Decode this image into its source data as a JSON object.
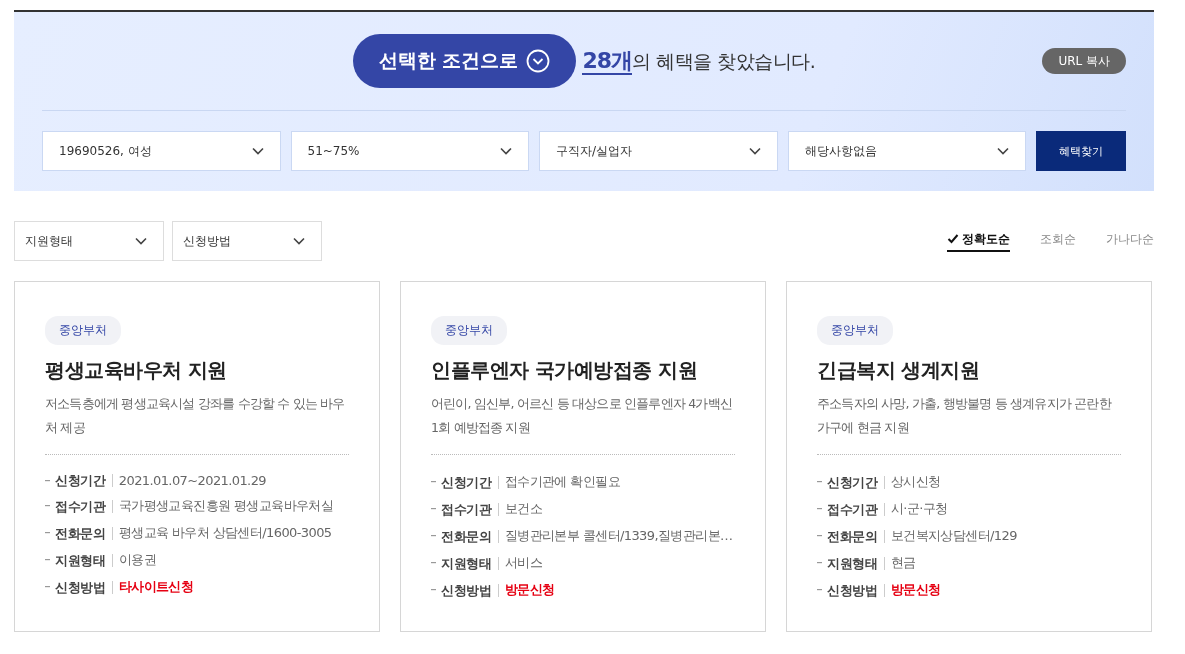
{
  "summary": {
    "toggle_label": "선택한 조건으로",
    "result_text": "**28개**의 혜택을 찾았습니다.",
    "copy_button": "URL 복사"
  },
  "conditions": [
    {
      "value": "19690526, 여성"
    },
    {
      "value": "51~75%"
    },
    {
      "value": "구직자/실업자"
    },
    {
      "value": "해당사항없음"
    }
  ],
  "search_button": "혜택찾기",
  "filters": [
    {
      "value": "지원형태"
    },
    {
      "value": "신청방법"
    }
  ],
  "sort_options": [
    {
      "label": "정확도순",
      "selected": true
    },
    {
      "label": "조회순",
      "selected": false
    },
    {
      "label": "가나다순",
      "selected": false
    }
  ],
  "cards": [
    {
      "badge": "중앙부처",
      "title": "평생교육바우처 지원",
      "description": "저소득층에게 평생교육시설 강좌를 수강할 수 있는 바우처 제공",
      "details": [
        {
          "label": "신청기간",
          "value": "2021.01.07~2021.01.29",
          "emphasis": false
        },
        {
          "label": "접수기관",
          "value": "국가평생교육진흥원 평생교육바우처실",
          "emphasis": false
        },
        {
          "label": "전화문의",
          "value": "평생교육 바우처 상담센터/1600-3005",
          "emphasis": false
        },
        {
          "label": "지원형태",
          "value": "이용권",
          "emphasis": false
        },
        {
          "label": "신청방법",
          "value": "타사이트신청",
          "emphasis": true
        }
      ]
    },
    {
      "badge": "중앙부처",
      "title": "인플루엔자 국가예방접종 지원",
      "description": "어린이, 임신부, 어르신 등 대상으로 인플루엔자 4가백신 1회 예방접종 지원",
      "details": [
        {
          "label": "신청기간",
          "value": "접수기관에 확인필요",
          "emphasis": false
        },
        {
          "label": "접수기관",
          "value": "보건소",
          "emphasis": false
        },
        {
          "label": "전화문의",
          "value": "질병관리본부 콜센터/1339,질병관리본…",
          "emphasis": false
        },
        {
          "label": "지원형태",
          "value": "서비스",
          "emphasis": false
        },
        {
          "label": "신청방법",
          "value": "방문신청",
          "emphasis": true
        }
      ]
    },
    {
      "badge": "중앙부처",
      "title": "긴급복지 생계지원",
      "description": "주소득자의 사망, 가출, 행방불명 등 생계유지가 곤란한 가구에 현금 지원",
      "details": [
        {
          "label": "신청기간",
          "value": "상시신청",
          "emphasis": false
        },
        {
          "label": "접수기관",
          "value": "시·군·구청",
          "emphasis": false
        },
        {
          "label": "전화문의",
          "value": "보건복지상담센터/129",
          "emphasis": false
        },
        {
          "label": "지원형태",
          "value": "현금",
          "emphasis": false
        },
        {
          "label": "신청방법",
          "value": "방문신청",
          "emphasis": true
        }
      ]
    }
  ]
}
